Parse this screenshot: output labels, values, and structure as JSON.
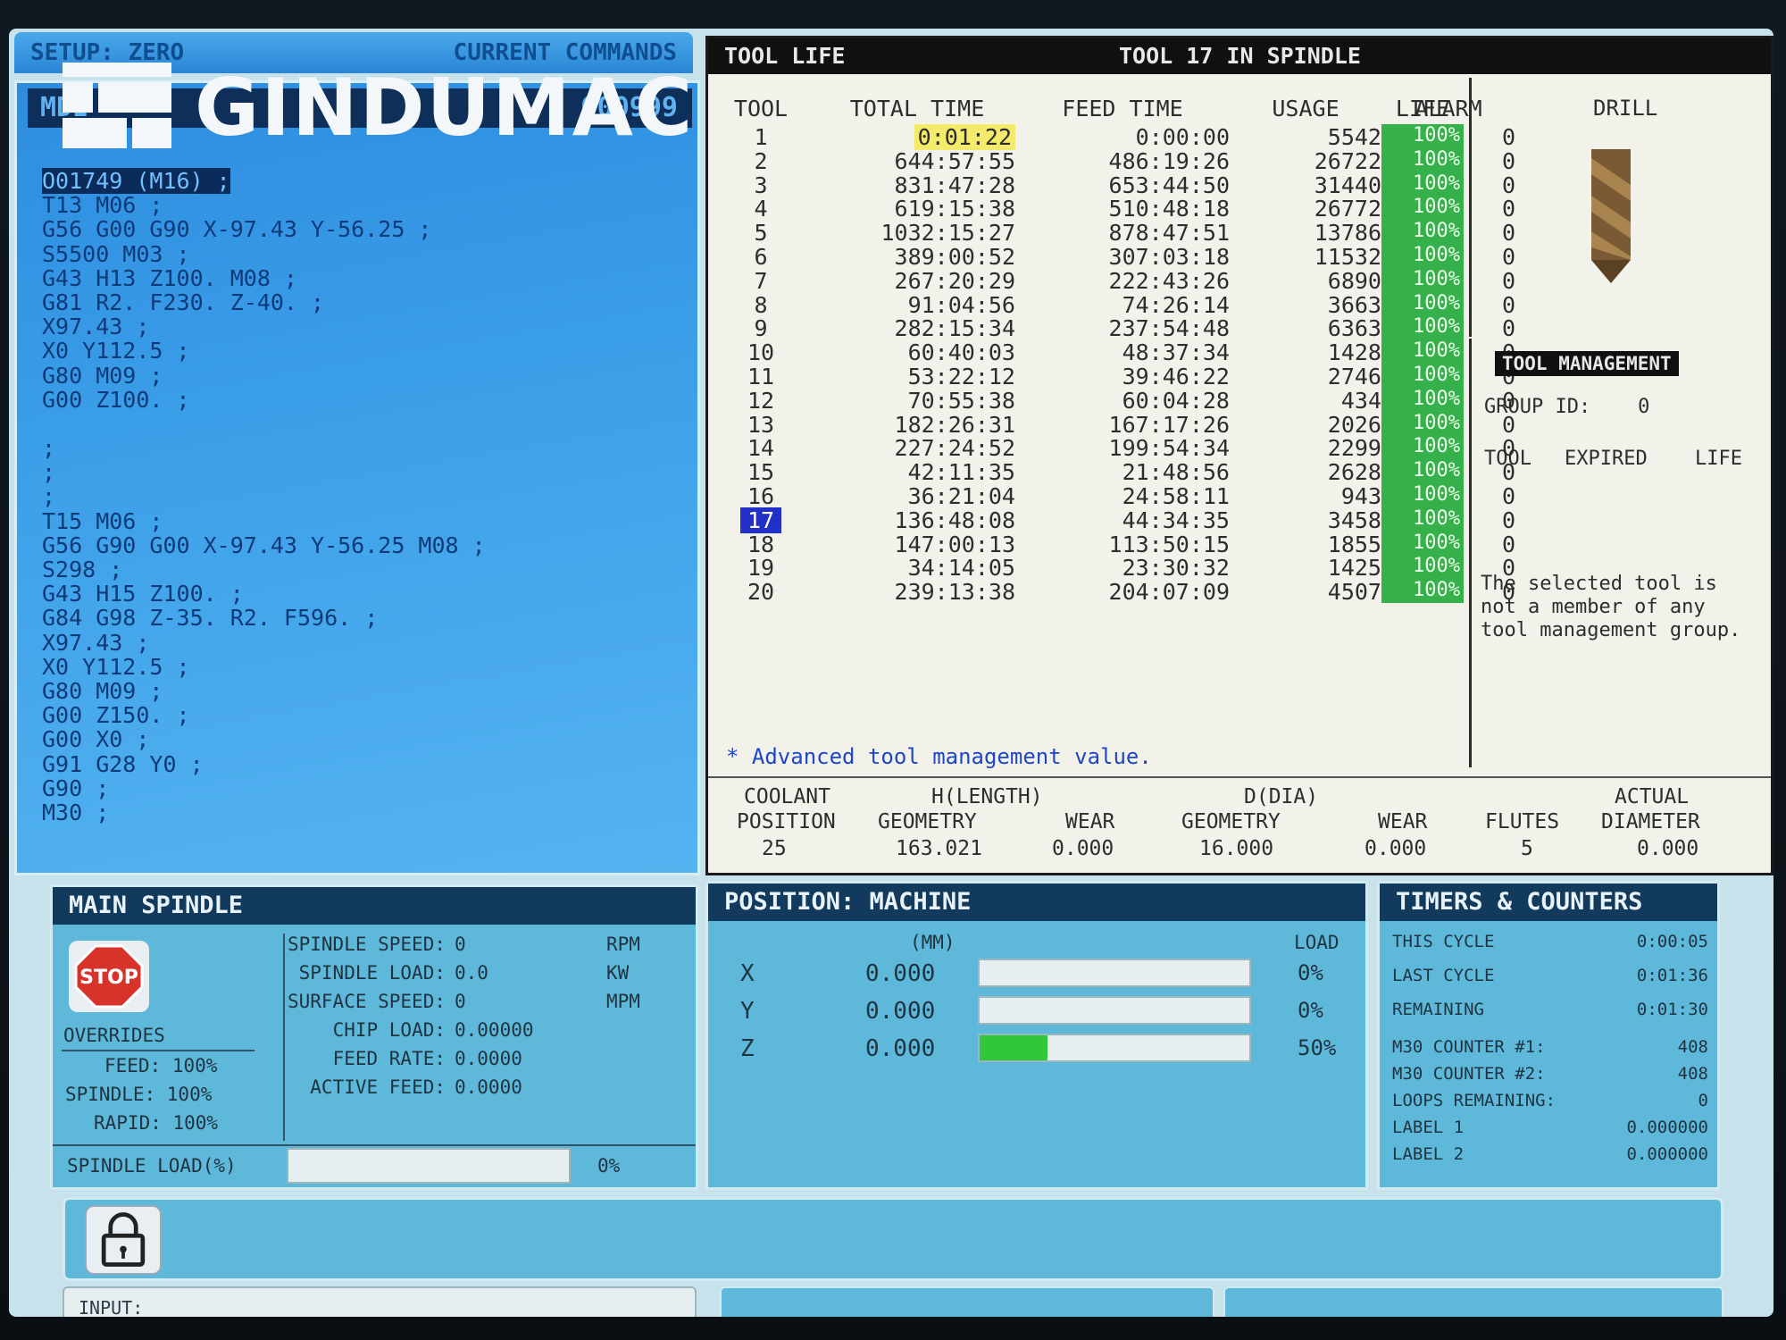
{
  "command_tabs": {
    "left": "SETUP: ZERO",
    "right": "CURRENT COMMANDS"
  },
  "program": {
    "header_left": "MDI",
    "header_right": "O00999",
    "lines": [
      "O01749 (M16) ;",
      "T13 M06 ;",
      "G56 G00 G90 X-97.43 Y-56.25 ;",
      "S5500 M03 ;",
      "G43 H13 Z100. M08 ;",
      "G81 R2. F230. Z-40. ;",
      "X97.43 ;",
      "X0 Y112.5 ;",
      "G80 M09 ;",
      "G00 Z100. ;",
      "",
      ";",
      ";",
      ";",
      "T15 M06 ;",
      "G56 G90 G00 X-97.43 Y-56.25 M08 ;",
      "S298 ;",
      "G43 H15 Z100. ;",
      "G84 G98 Z-35. R2. F596. ;",
      "X97.43 ;",
      "X0 Y112.5 ;",
      "G80 M09 ;",
      "G00 Z150. ;",
      "G00 X0 ;",
      "G91 G28 Y0 ;",
      "G90 ;",
      "M30 ;"
    ]
  },
  "watermark": {
    "text": "GINDUMAC"
  },
  "tool_life": {
    "title": "TOOL LIFE",
    "spindle_status": "TOOL  17 IN SPINDLE",
    "headers": {
      "tool": "TOOL",
      "total_time": "TOTAL TIME",
      "feed_time": "FEED TIME",
      "usage": "USAGE",
      "alarm": "ALARM",
      "life": "LIFE"
    },
    "rows": [
      {
        "tool": "1",
        "total": "0:01:22",
        "feed": "0:00:00",
        "usage": "5542",
        "alarm": "0",
        "life": "100%"
      },
      {
        "tool": "2",
        "total": "644:57:55",
        "feed": "486:19:26",
        "usage": "26722",
        "alarm": "0",
        "life": "100%"
      },
      {
        "tool": "3",
        "total": "831:47:28",
        "feed": "653:44:50",
        "usage": "31440",
        "alarm": "0",
        "life": "100%"
      },
      {
        "tool": "4",
        "total": "619:15:38",
        "feed": "510:48:18",
        "usage": "26772",
        "alarm": "0",
        "life": "100%"
      },
      {
        "tool": "5",
        "total": "1032:15:27",
        "feed": "878:47:51",
        "usage": "13786",
        "alarm": "0",
        "life": "100%"
      },
      {
        "tool": "6",
        "total": "389:00:52",
        "feed": "307:03:18",
        "usage": "11532",
        "alarm": "0",
        "life": "100%"
      },
      {
        "tool": "7",
        "total": "267:20:29",
        "feed": "222:43:26",
        "usage": "6890",
        "alarm": "0",
        "life": "100%"
      },
      {
        "tool": "8",
        "total": "91:04:56",
        "feed": "74:26:14",
        "usage": "3663",
        "alarm": "0",
        "life": "100%"
      },
      {
        "tool": "9",
        "total": "282:15:34",
        "feed": "237:54:48",
        "usage": "6363",
        "alarm": "0",
        "life": "100%"
      },
      {
        "tool": "10",
        "total": "60:40:03",
        "feed": "48:37:34",
        "usage": "1428",
        "alarm": "0",
        "life": "100%"
      },
      {
        "tool": "11",
        "total": "53:22:12",
        "feed": "39:46:22",
        "usage": "2746",
        "alarm": "0",
        "life": "100%"
      },
      {
        "tool": "12",
        "total": "70:55:38",
        "feed": "60:04:28",
        "usage": "434",
        "alarm": "0",
        "life": "100%"
      },
      {
        "tool": "13",
        "total": "182:26:31",
        "feed": "167:17:26",
        "usage": "2026",
        "alarm": "0",
        "life": "100%"
      },
      {
        "tool": "14",
        "total": "227:24:52",
        "feed": "199:54:34",
        "usage": "2299",
        "alarm": "0",
        "life": "100%"
      },
      {
        "tool": "15",
        "total": "42:11:35",
        "feed": "21:48:56",
        "usage": "2628",
        "alarm": "0",
        "life": "100%"
      },
      {
        "tool": "16",
        "total": "36:21:04",
        "feed": "24:58:11",
        "usage": "943",
        "alarm": "0",
        "life": "100%"
      },
      {
        "tool": "17",
        "total": "136:48:08",
        "feed": "44:34:35",
        "usage": "3458",
        "alarm": "0",
        "life": "100%"
      },
      {
        "tool": "18",
        "total": "147:00:13",
        "feed": "113:50:15",
        "usage": "1855",
        "alarm": "0",
        "life": "100%"
      },
      {
        "tool": "19",
        "total": "34:14:05",
        "feed": "23:30:32",
        "usage": "1425",
        "alarm": "0",
        "life": "100%"
      },
      {
        "tool": "20",
        "total": "239:13:38",
        "feed": "204:07:09",
        "usage": "4507",
        "alarm": "0",
        "life": "100%"
      }
    ],
    "note": "* Advanced tool management value.",
    "geometry": {
      "coolant_label": "COOLANT",
      "h_length_label": "H(LENGTH)",
      "d_dia_label": "D(DIA)",
      "actual_label": "ACTUAL",
      "position_label": "POSITION",
      "h_geometry_label": "GEOMETRY",
      "h_wear_label": "WEAR",
      "d_geometry_label": "GEOMETRY",
      "d_wear_label": "WEAR",
      "flutes_label": "FLUTES",
      "diameter_label": "DIAMETER",
      "coolant_position": "25",
      "h_geometry": "163.021",
      "h_wear": "0.000",
      "d_geometry": "16.000",
      "d_wear": "0.000",
      "flutes": "5",
      "actual_diameter": "0.000"
    },
    "drill_label": "DRILL",
    "tool_management": {
      "title": "TOOL MANAGEMENT",
      "group_id": "GROUP ID:    0",
      "col_tool": "TOOL",
      "col_expired": "EXPIRED",
      "col_life": "LIFE",
      "message": "The selected tool is not a member of any tool management group."
    }
  },
  "main_spindle": {
    "title": "MAIN SPINDLE",
    "stop_text": "STOP",
    "overrides_label": "OVERRIDES",
    "feed_override": "FEED: 100%",
    "spindle_override": "SPINDLE: 100%",
    "rapid_override": "RAPID: 100%",
    "rows": [
      {
        "label": "SPINDLE SPEED:",
        "value": "0",
        "unit": "RPM"
      },
      {
        "label": "SPINDLE LOAD:",
        "value": "0.0",
        "unit": "KW"
      },
      {
        "label": "SURFACE SPEED:",
        "value": "0",
        "unit": "MPM"
      },
      {
        "label": "CHIP LOAD:",
        "value": "0.00000",
        "unit": ""
      },
      {
        "label": "FEED RATE:",
        "value": "0.0000",
        "unit": ""
      },
      {
        "label": "ACTIVE FEED:",
        "value": "0.0000",
        "unit": ""
      }
    ],
    "load_label": "SPINDLE LOAD(%)",
    "load_value": "0%",
    "load_fraction": 0
  },
  "position": {
    "title": "POSITION: MACHINE",
    "unit": "(MM)",
    "load_header": "LOAD",
    "axes": [
      {
        "axis": "X",
        "value": "0.000",
        "load": "0%",
        "load_fraction": 0
      },
      {
        "axis": "Y",
        "value": "0.000",
        "load": "0%",
        "load_fraction": 0
      },
      {
        "axis": "Z",
        "value": "0.000",
        "load": "50%",
        "load_fraction": 0.25
      }
    ]
  },
  "timers": {
    "title": "TIMERS & COUNTERS",
    "rows": [
      {
        "label": "THIS CYCLE",
        "value": "0:00:05"
      },
      {
        "label": "LAST CYCLE",
        "value": "0:01:36"
      },
      {
        "label": "REMAINING",
        "value": "0:01:30"
      },
      {
        "label": "M30 COUNTER #1:",
        "value": "408"
      },
      {
        "label": "M30 COUNTER #2:",
        "value": "408"
      },
      {
        "label": "LOOPS REMAINING:",
        "value": "0"
      },
      {
        "label": "LABEL 1",
        "value": "0.000000"
      },
      {
        "label": "LABEL 2",
        "value": "0.000000"
      }
    ]
  },
  "input": {
    "label": "INPUT:"
  },
  "colors": {
    "life_green": "#36b04a",
    "selected_tool": "#2230c8",
    "highlight_yellow": "#f4ea6b",
    "stop_red": "#d8332a"
  },
  "icons": [
    "lock-icon",
    "stop-sign-icon",
    "drill-icon",
    "gindumac-logo"
  ]
}
